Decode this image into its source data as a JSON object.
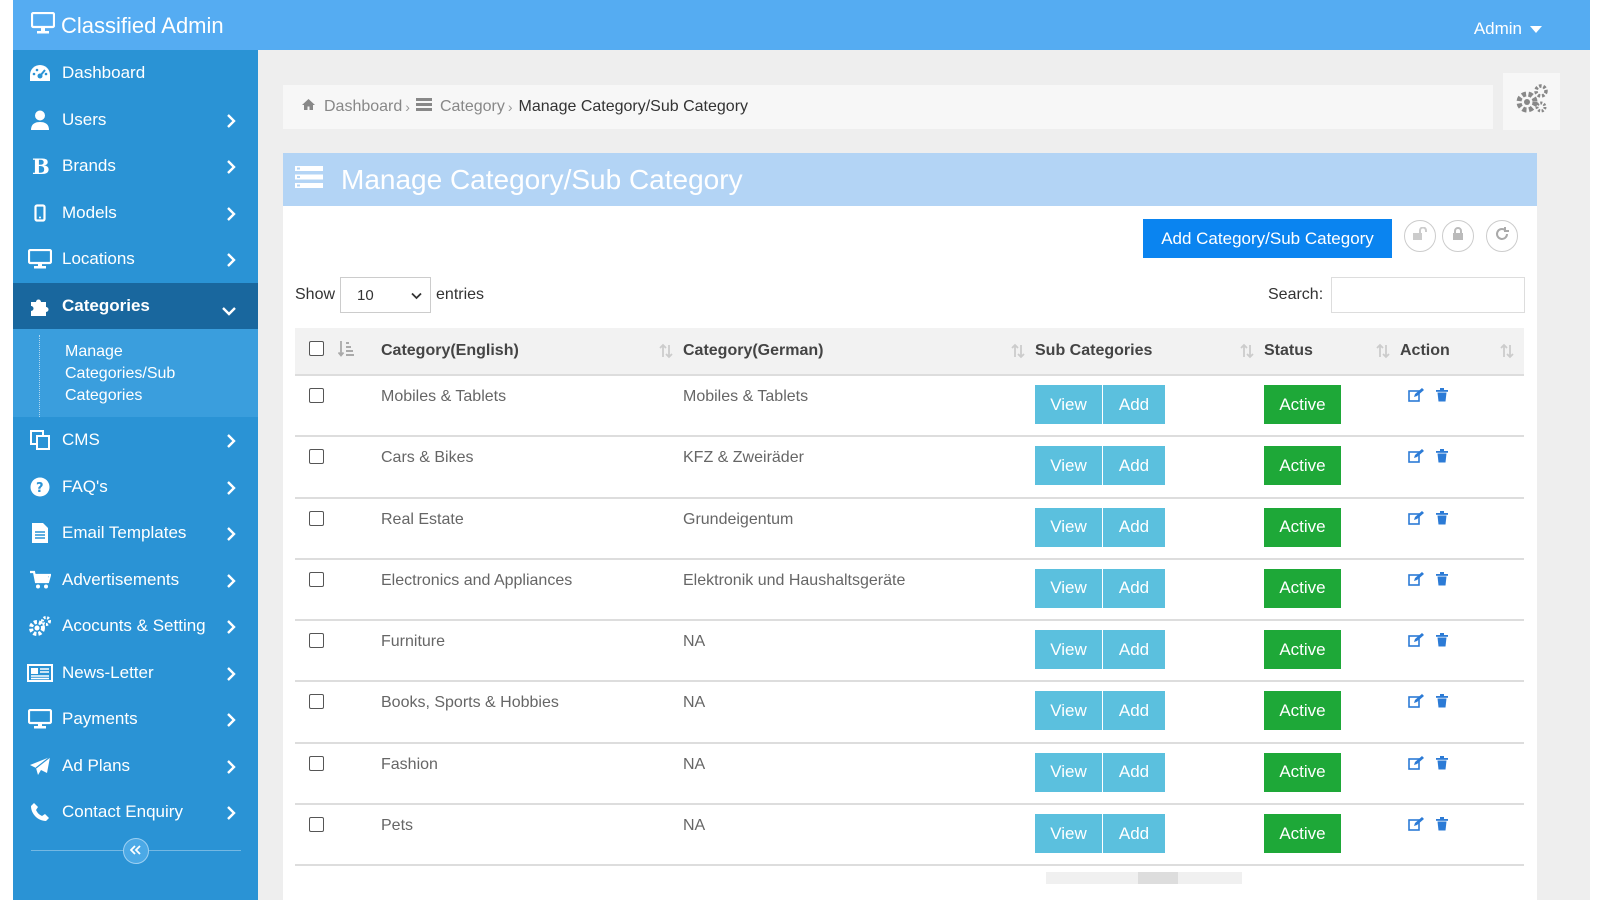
{
  "app": {
    "title": "Classified Admin",
    "user_menu": "Admin"
  },
  "sidebar": {
    "items": [
      {
        "label": "Dashboard",
        "icon": "dashboard-icon"
      },
      {
        "label": "Users",
        "icon": "user-icon"
      },
      {
        "label": "Brands",
        "icon": "brand-b-icon"
      },
      {
        "label": "Models",
        "icon": "mobile-icon"
      },
      {
        "label": "Locations",
        "icon": "monitor-icon"
      },
      {
        "label": "Categories",
        "icon": "puzzle-icon"
      },
      {
        "label": "CMS",
        "icon": "copy-icon"
      },
      {
        "label": "FAQ's",
        "icon": "question-icon"
      },
      {
        "label": "Email Templates",
        "icon": "file-icon"
      },
      {
        "label": "Advertisements",
        "icon": "cart-icon"
      },
      {
        "label": "Acocunts & Setting",
        "icon": "gears-icon"
      },
      {
        "label": "News-Letter",
        "icon": "newspaper-icon"
      },
      {
        "label": "Payments",
        "icon": "monitor-icon"
      },
      {
        "label": "Ad Plans",
        "icon": "paper-plane-icon"
      },
      {
        "label": "Contact Enquiry",
        "icon": "phone-icon"
      }
    ],
    "active": "Categories",
    "sub_item": "Manage Categories/Sub Categories"
  },
  "breadcrumb": {
    "home": "Dashboard",
    "section": "Category",
    "current": "Manage Category/Sub Category"
  },
  "panel": {
    "title": "Manage Category/Sub Category",
    "add_button": "Add Category/Sub Category",
    "show_label": "Show",
    "entries_value": "10",
    "entries_label": "entries",
    "search_label": "Search:"
  },
  "table": {
    "headers": {
      "english": "Category(English)",
      "german": "Category(German)",
      "sub": "Sub Categories",
      "status": "Status",
      "action": "Action"
    },
    "view_label": "View",
    "add_label": "Add",
    "rows": [
      {
        "english": "Mobiles & Tablets",
        "german": "Mobiles & Tablets",
        "status": "Active"
      },
      {
        "english": "Cars & Bikes",
        "german": "KFZ & Zweiräder",
        "status": "Active"
      },
      {
        "english": "Real Estate",
        "german": "Grundeigentum",
        "status": "Active"
      },
      {
        "english": "Electronics and Appliances",
        "german": "Elektronik und Haushaltsgeräte",
        "status": "Active"
      },
      {
        "english": "Furniture",
        "german": "NA",
        "status": "Active"
      },
      {
        "english": "Books, Sports & Hobbies",
        "german": "NA",
        "status": "Active"
      },
      {
        "english": "Fashion",
        "german": "NA",
        "status": "Active"
      },
      {
        "english": "Pets",
        "german": "NA",
        "status": "Active"
      }
    ]
  },
  "colors": {
    "topbar": "#55acf2",
    "sidebar": "#2a93d5",
    "sidebar_active": "#19679e",
    "primary": "#0a84f0",
    "info": "#5bc0de",
    "success": "#1ea838"
  }
}
